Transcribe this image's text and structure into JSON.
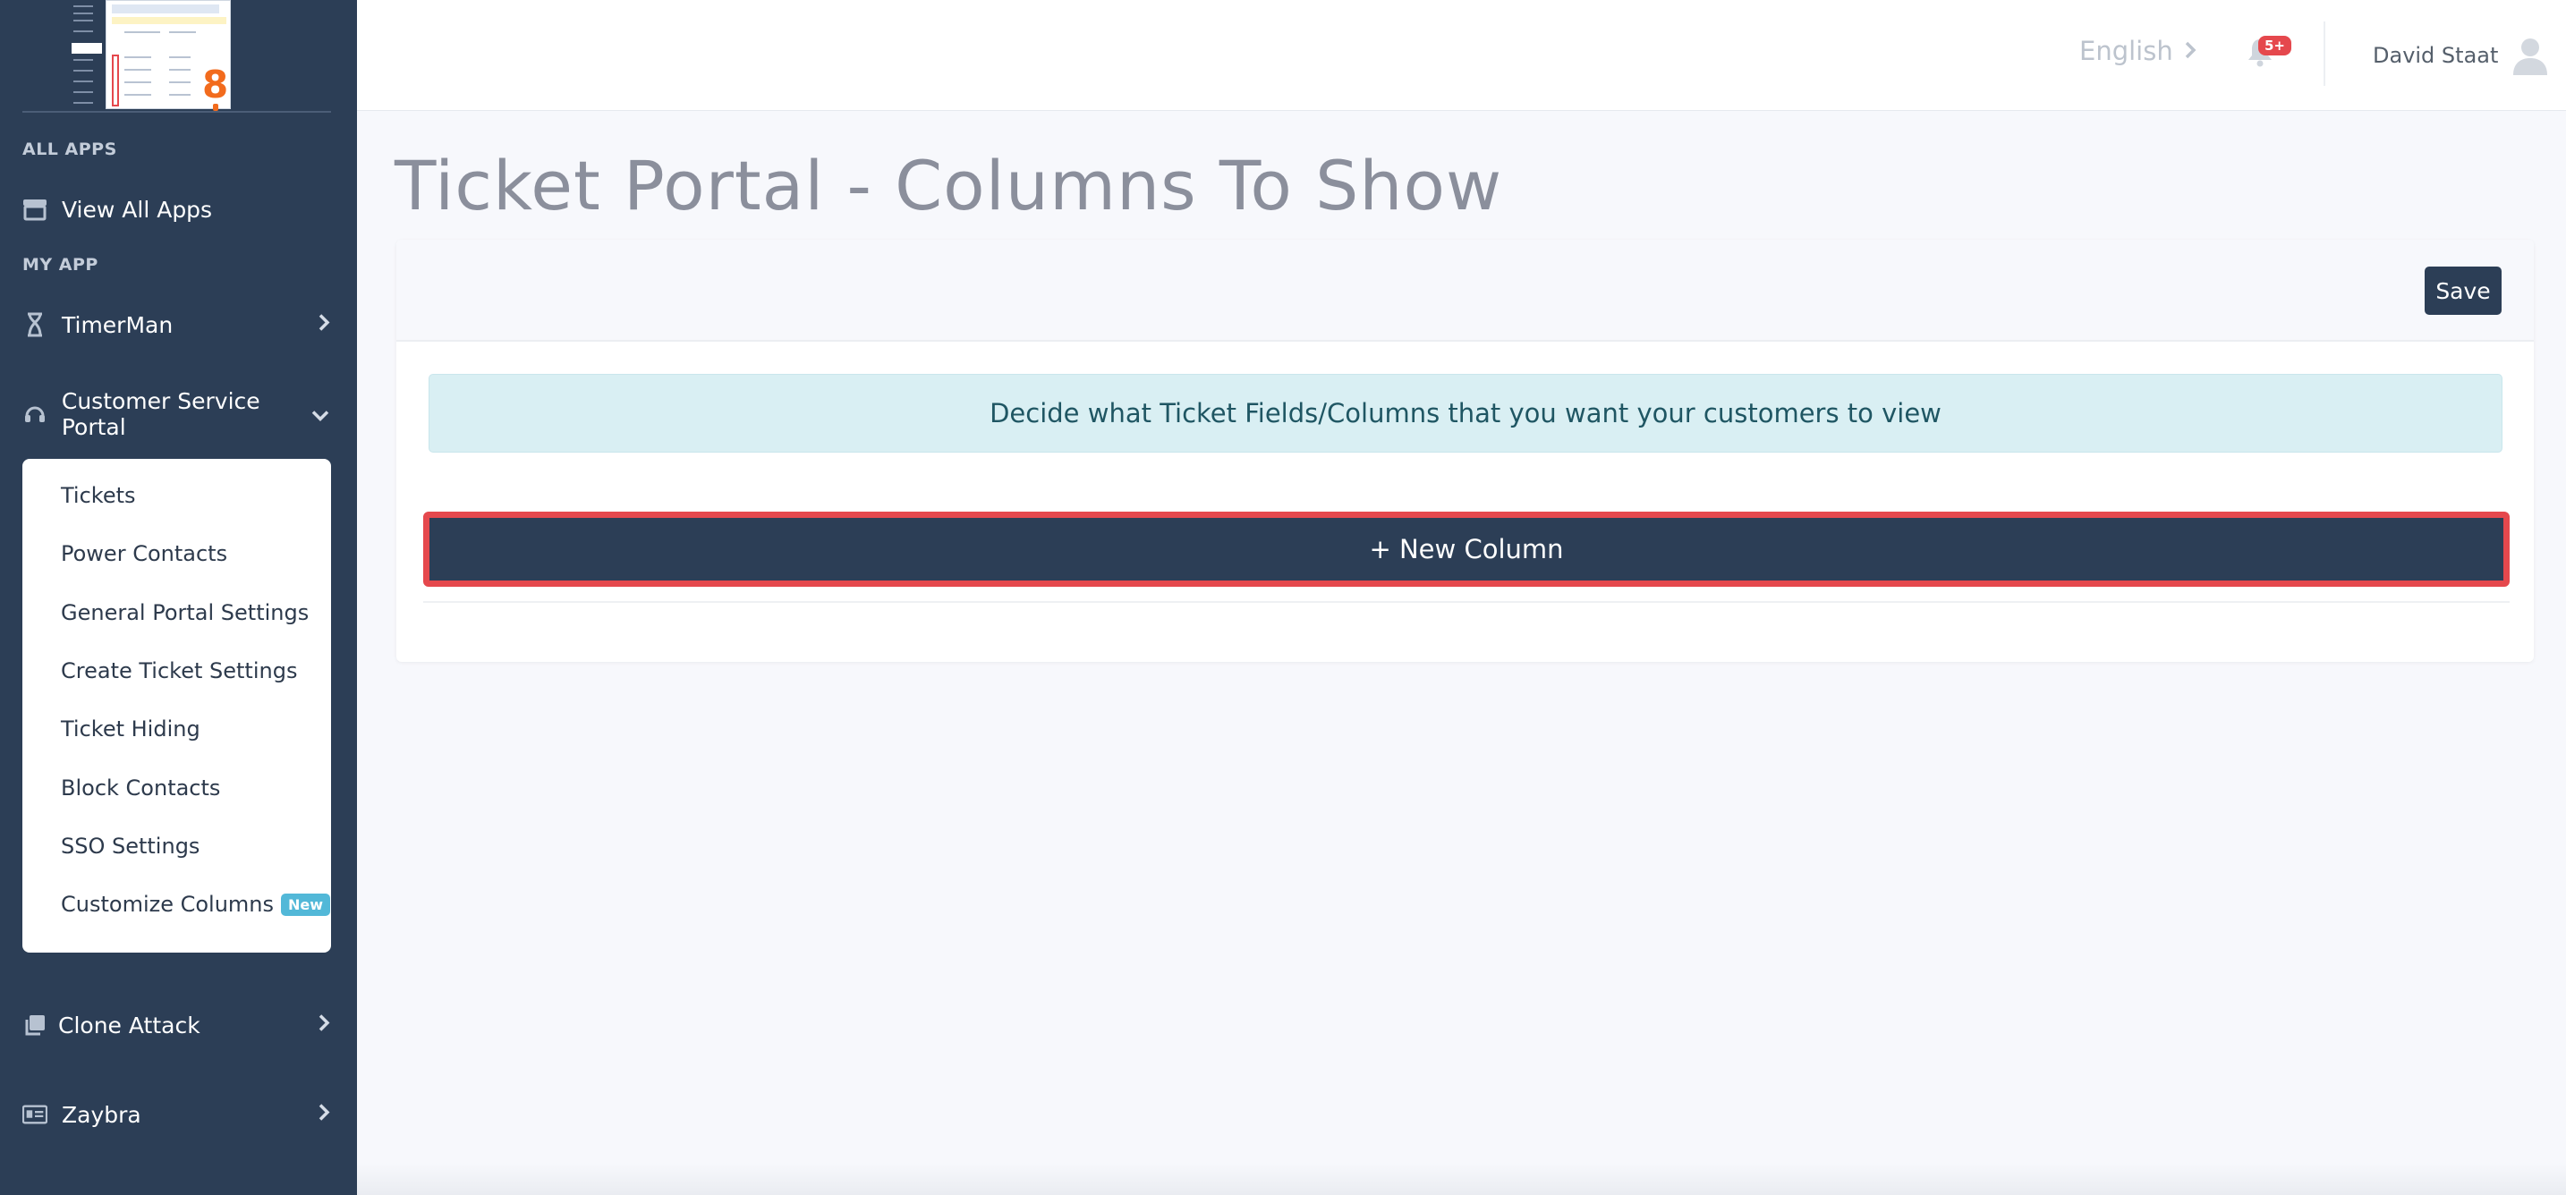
{
  "sidebar": {
    "section_all_apps": "ALL APPS",
    "view_all_apps": "View All Apps",
    "section_my_app": "MY APP",
    "timerman": "TimerMan",
    "customer_service_portal": "Customer Service Portal",
    "submenu": [
      {
        "label": "Tickets"
      },
      {
        "label": "Power Contacts"
      },
      {
        "label": "General Portal Settings"
      },
      {
        "label": "Create Ticket Settings"
      },
      {
        "label": "Ticket Hiding"
      },
      {
        "label": "Block Contacts"
      },
      {
        "label": "SSO Settings"
      },
      {
        "label": "Customize Columns",
        "badge": "New"
      }
    ],
    "clone_attack": "Clone Attack",
    "zaybra": "Zaybra"
  },
  "topbar": {
    "language": "English",
    "notifications_badge": "5+",
    "user_name": "David Staat"
  },
  "main": {
    "title": "Ticket Portal - Columns To Show",
    "save_label": "Save",
    "info_text": "Decide what Ticket Fields/Columns that you want your customers to view",
    "new_column_label": "+ New Column"
  },
  "colors": {
    "sidebar_bg": "#2c3e56",
    "primary_button": "#2c3e56",
    "highlight_outline": "#e5484d",
    "info_bg": "#d9eff3",
    "badge_new": "#52b8d8"
  }
}
